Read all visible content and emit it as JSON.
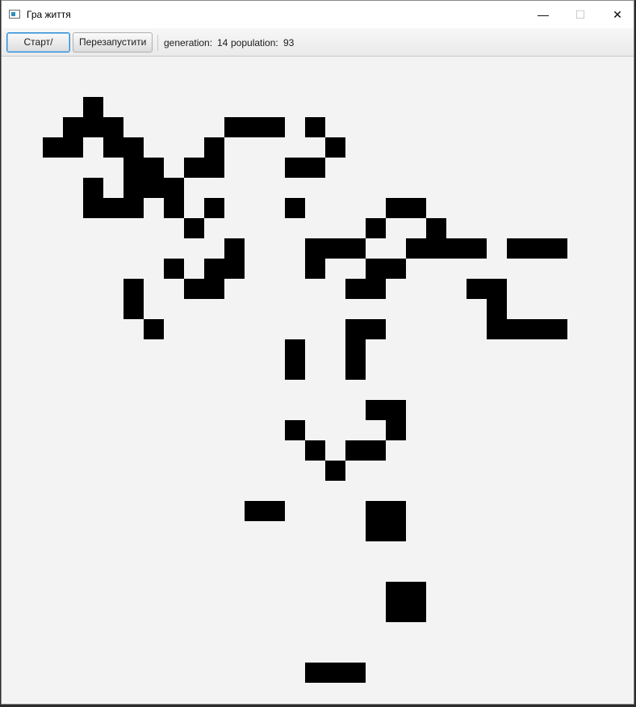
{
  "window": {
    "title": "Гра життя",
    "icon": "window-app-icon"
  },
  "titlebar_controls": {
    "minimize": "—",
    "maximize": "☐",
    "close": "✕"
  },
  "toolbar": {
    "start_stop_label": "Старт/Стоп",
    "restart_label": "Перезапустити",
    "generation_label": "generation:",
    "generation_value": "14",
    "population_label": "population:",
    "population_value": "93"
  },
  "grid": {
    "cell_color": "#000000",
    "background_color": "#f3f3f3",
    "live_cells": [
      [
        4,
        2
      ],
      [
        3,
        3
      ],
      [
        4,
        3
      ],
      [
        5,
        3
      ],
      [
        11,
        3
      ],
      [
        12,
        3
      ],
      [
        13,
        3
      ],
      [
        15,
        3
      ],
      [
        2,
        4
      ],
      [
        3,
        4
      ],
      [
        5,
        4
      ],
      [
        6,
        4
      ],
      [
        10,
        4
      ],
      [
        16,
        4
      ],
      [
        6,
        5
      ],
      [
        7,
        5
      ],
      [
        9,
        5
      ],
      [
        10,
        5
      ],
      [
        14,
        5
      ],
      [
        15,
        5
      ],
      [
        4,
        6
      ],
      [
        6,
        6
      ],
      [
        7,
        6
      ],
      [
        8,
        6
      ],
      [
        4,
        7
      ],
      [
        5,
        7
      ],
      [
        6,
        7
      ],
      [
        8,
        7
      ],
      [
        10,
        7
      ],
      [
        14,
        7
      ],
      [
        19,
        7
      ],
      [
        20,
        7
      ],
      [
        9,
        8
      ],
      [
        18,
        8
      ],
      [
        21,
        8
      ],
      [
        11,
        9
      ],
      [
        15,
        9
      ],
      [
        16,
        9
      ],
      [
        17,
        9
      ],
      [
        20,
        9
      ],
      [
        21,
        9
      ],
      [
        22,
        9
      ],
      [
        23,
        9
      ],
      [
        25,
        9
      ],
      [
        26,
        9
      ],
      [
        27,
        9
      ],
      [
        8,
        10
      ],
      [
        10,
        10
      ],
      [
        11,
        10
      ],
      [
        15,
        10
      ],
      [
        18,
        10
      ],
      [
        19,
        10
      ],
      [
        6,
        11
      ],
      [
        9,
        11
      ],
      [
        10,
        11
      ],
      [
        17,
        11
      ],
      [
        18,
        11
      ],
      [
        23,
        11
      ],
      [
        24,
        11
      ],
      [
        6,
        12
      ],
      [
        24,
        12
      ],
      [
        7,
        13
      ],
      [
        17,
        13
      ],
      [
        18,
        13
      ],
      [
        24,
        13
      ],
      [
        25,
        13
      ],
      [
        26,
        13
      ],
      [
        27,
        13
      ],
      [
        14,
        14
      ],
      [
        17,
        14
      ],
      [
        14,
        15
      ],
      [
        17,
        15
      ],
      [
        18,
        17
      ],
      [
        19,
        17
      ],
      [
        14,
        18
      ],
      [
        19,
        18
      ],
      [
        15,
        19
      ],
      [
        17,
        19
      ],
      [
        18,
        19
      ],
      [
        16,
        20
      ],
      [
        12,
        22
      ],
      [
        13,
        22
      ],
      [
        18,
        22
      ],
      [
        19,
        22
      ],
      [
        18,
        23
      ],
      [
        19,
        23
      ],
      [
        19,
        26
      ],
      [
        20,
        26
      ],
      [
        19,
        27
      ],
      [
        20,
        27
      ],
      [
        15,
        30
      ],
      [
        16,
        30
      ],
      [
        17,
        30
      ]
    ]
  }
}
